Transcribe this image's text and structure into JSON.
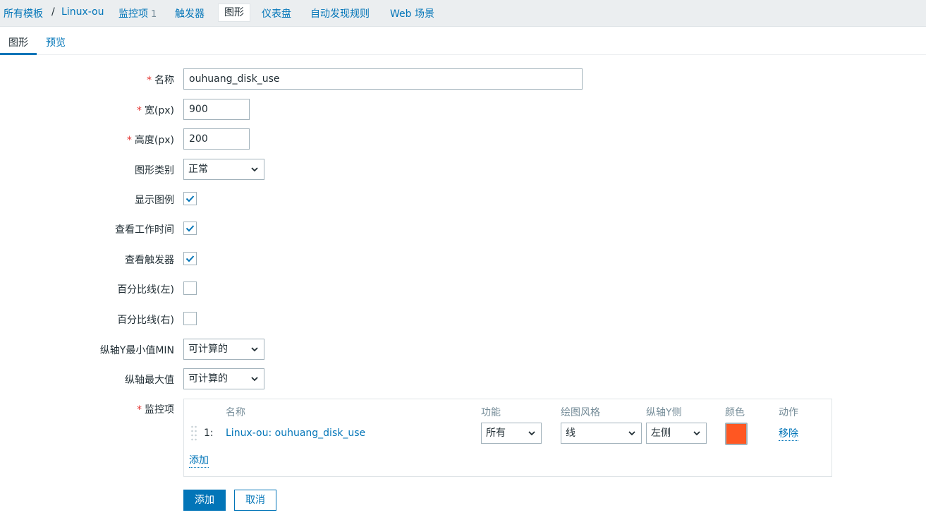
{
  "breadcrumb": {
    "all_templates": "所有模板",
    "separator": "/",
    "template": "Linux-ou"
  },
  "nav": {
    "items_label": "监控项",
    "items_count": "1",
    "triggers": "触发器",
    "graphs": "图形",
    "dashboards": "仪表盘",
    "discovery": "自动发现规则",
    "web": "Web 场景"
  },
  "tabs": {
    "graph": "图形",
    "preview": "预览"
  },
  "form": {
    "required_mark": "*",
    "name_label": "名称",
    "name_value": "ouhuang_disk_use",
    "width_label": "宽(px)",
    "width_value": "900",
    "height_label": "高度(px)",
    "height_value": "200",
    "type_label": "图形类别",
    "type_value": "正常",
    "show_legend_label": "显示图例",
    "show_legend": true,
    "show_work_period_label": "查看工作时间",
    "show_work_period": true,
    "show_triggers_label": "查看触发器",
    "show_triggers": true,
    "percentile_left_label": "百分比线(左)",
    "percentile_left": false,
    "percentile_right_label": "百分比线(右)",
    "percentile_right": false,
    "ymin_label": "纵轴Y最小值MIN",
    "ymin_value": "可计算的",
    "ymax_label": "纵轴最大值",
    "ymax_value": "可计算的",
    "items_label": "监控项"
  },
  "items_table": {
    "headers": {
      "name": "名称",
      "function": "功能",
      "draw_style": "绘图风格",
      "y_side": "纵轴Y侧",
      "color": "颜色",
      "action": "动作"
    },
    "rows": [
      {
        "index": "1:",
        "name": "Linux-ou: ouhuang_disk_use",
        "function": "所有",
        "draw_style": "线",
        "y_side": "左侧",
        "color": "#FF5722",
        "action": "移除"
      }
    ],
    "add_link": "添加"
  },
  "buttons": {
    "add": "添加",
    "cancel": "取消"
  }
}
